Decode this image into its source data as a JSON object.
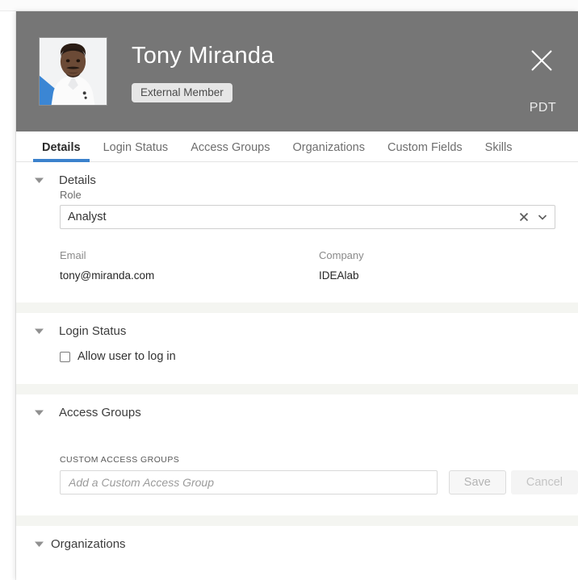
{
  "header": {
    "name": "Tony Miranda",
    "badge": "External Member",
    "timezone": "PDT",
    "close_icon": "close-icon",
    "avatar_icon": "user-photo"
  },
  "tabs": [
    {
      "label": "Details",
      "active": true
    },
    {
      "label": "Login Status",
      "active": false
    },
    {
      "label": "Access Groups",
      "active": false
    },
    {
      "label": "Organizations",
      "active": false
    },
    {
      "label": "Custom Fields",
      "active": false
    },
    {
      "label": "Skills",
      "active": false
    }
  ],
  "details": {
    "section_title": "Details",
    "role_label": "Role",
    "role_value": "Analyst",
    "clear_icon": "clear-x-icon",
    "chevron_icon": "chevron-down-icon",
    "email_label": "Email",
    "email_value": "tony@miranda.com",
    "company_label": "Company",
    "company_value": "IDEAlab"
  },
  "login_status": {
    "section_title": "Login Status",
    "checkbox_label": "Allow user to log in",
    "checked": false
  },
  "access_groups": {
    "section_title": "Access Groups",
    "custom_label": "CUSTOM ACCESS GROUPS",
    "input_value": "",
    "input_placeholder": "Add a Custom Access Group",
    "save_label": "Save",
    "cancel_label": "Cancel"
  },
  "organizations": {
    "section_title": "Organizations"
  },
  "colors": {
    "header_bg": "#767676",
    "accent": "#3b82cc",
    "divider_band": "#f4f5f1",
    "avatar_accent": "#3b86d4"
  }
}
